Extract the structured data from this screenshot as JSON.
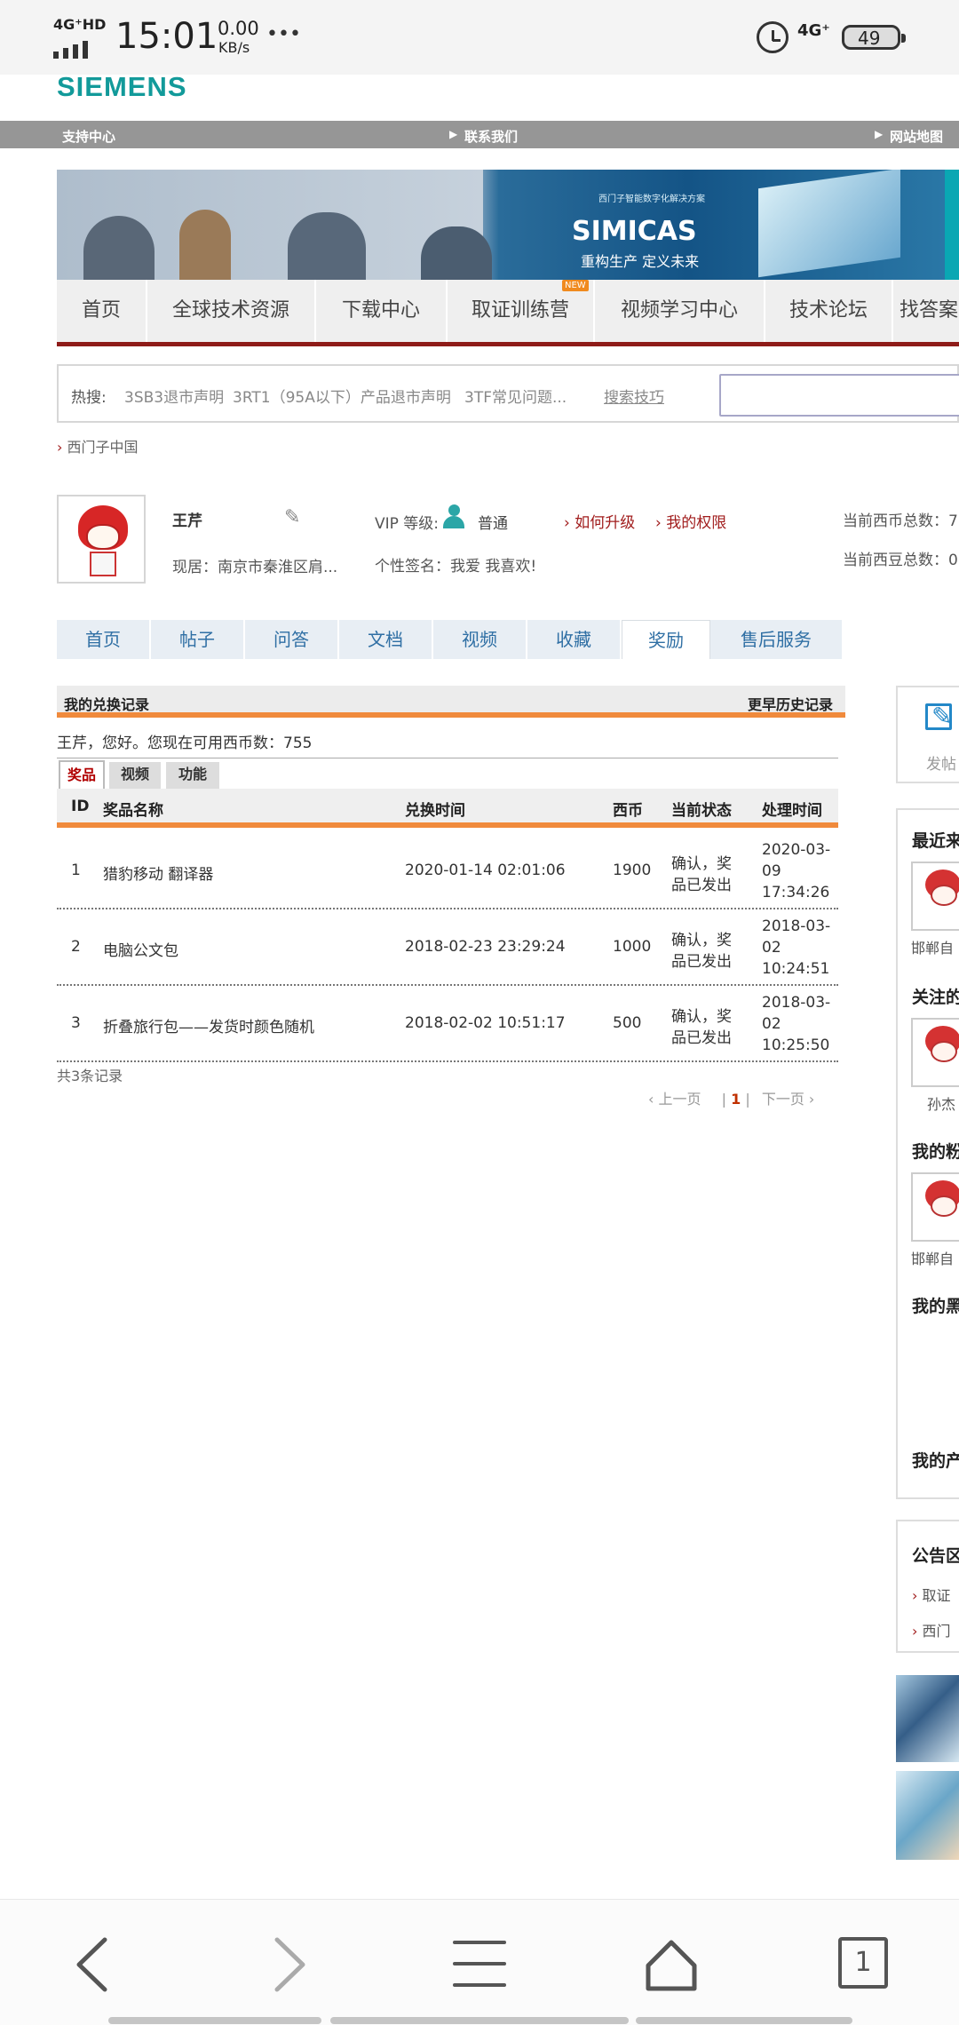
{
  "status_bar": {
    "network": "4G⁺HD",
    "time": "15:01",
    "speed_value": "0.00",
    "speed_unit": "KB/s",
    "more": "•••",
    "network_right": "4G⁺",
    "battery": "49"
  },
  "header": {
    "logo": "SIEMENS",
    "gray_nav": [
      "支持中心",
      "联系我们",
      "网站地图"
    ]
  },
  "banner": {
    "title": "SIMICAS",
    "subtitle": "重构生产 定义未来",
    "small_text": "西门子智能数字化解决方案"
  },
  "main_nav": [
    {
      "label": "首页"
    },
    {
      "label": "全球技术资源"
    },
    {
      "label": "下载中心"
    },
    {
      "label": "取证训练营",
      "badge": "NEW"
    },
    {
      "label": "视频学习中心"
    },
    {
      "label": "技术论坛"
    },
    {
      "label": "找答案"
    }
  ],
  "hot": {
    "label": "热搜:",
    "items": [
      "3SB3退市声明",
      "3RT1（95A以下）产品退市声明",
      "3TF常见问题..."
    ],
    "tips": "搜索技巧",
    "search_value": ""
  },
  "breadcrumb": "西门子中国",
  "profile": {
    "name": "王芹",
    "location": "现居：南京市秦淮区肩...",
    "vip_label": "VIP 等级:",
    "vip_value": "普通",
    "upgrade": "如何升级",
    "rights": "我的权限",
    "signature": "个性签名：我爱 我喜欢!",
    "coin_total": "当前西币总数：7",
    "bean_total": "当前西豆总数：0"
  },
  "profile_tabs": [
    "首页",
    "帖子",
    "问答",
    "文档",
    "视频",
    "收藏",
    "奖励",
    "售后服务"
  ],
  "records": {
    "title": "我的兑换记录",
    "history": "更早历史记录",
    "summary": "王芹，您好。您现在可用西币数：755",
    "type_tabs": [
      "奖品",
      "视频",
      "功能"
    ],
    "columns": [
      "ID",
      "奖品名称",
      "兑换时间",
      "西币",
      "当前状态",
      "处理时间"
    ],
    "rows": [
      {
        "id": "1",
        "name": "猎豹移动 翻译器",
        "exchange_time": "2020-01-14 02:01:06",
        "coins": "1900",
        "status_1": "确认，奖",
        "status_2": "品已发出",
        "process_1": "2020-03-",
        "process_2": "09",
        "process_3": "17:34:26"
      },
      {
        "id": "2",
        "name": "电脑公文包",
        "exchange_time": "2018-02-23 23:29:24",
        "coins": "1000",
        "status_1": "确认，奖",
        "status_2": "品已发出",
        "process_1": "2018-03-",
        "process_2": "02",
        "process_3": "10:24:51"
      },
      {
        "id": "3",
        "name": "折叠旅行包——发货时颜色随机",
        "exchange_time": "2018-02-02 10:51:17",
        "coins": "500",
        "status_1": "确认，奖",
        "status_2": "品已发出",
        "process_1": "2018-03-",
        "process_2": "02",
        "process_3": "10:25:50"
      }
    ],
    "count": "共3条记录",
    "pager_prev": "上一页",
    "pager_current": "1",
    "pager_next": "下一页"
  },
  "sidebar": {
    "post": "发帖",
    "recent": "最近来",
    "recent_user": "邯郸自",
    "follow": "关注的",
    "follow_user": "孙杰",
    "fans": "我的粉",
    "fans_user": "邯郸自",
    "black": "我的黑",
    "product": "我的产",
    "notice": "公告区",
    "notice_1": "取证",
    "notice_2": "西门"
  },
  "browser": {
    "tab_count": "1"
  }
}
